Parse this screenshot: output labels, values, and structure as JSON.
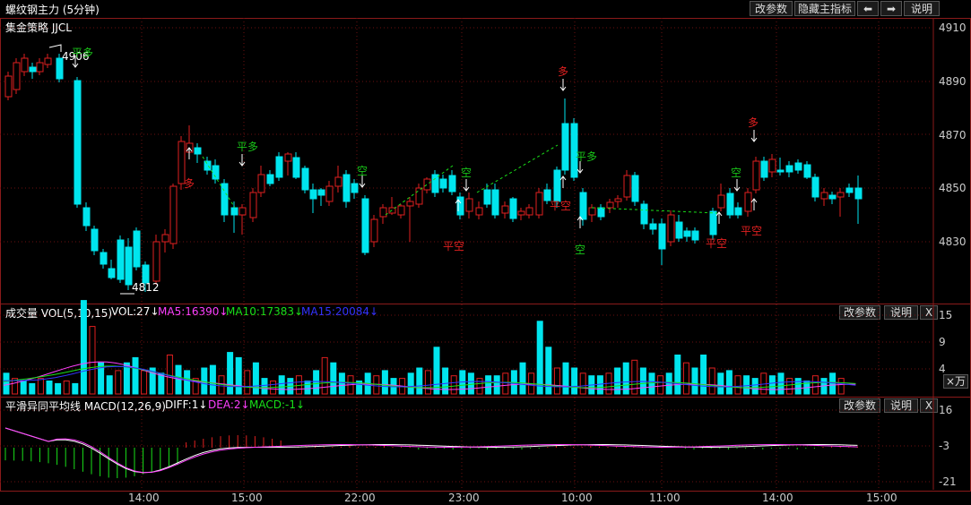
{
  "window": {
    "title": "螺纹钢主力 (5分钟)"
  },
  "toolbar": {
    "change_params": "改参数",
    "hide_main": "隐藏主指标",
    "prev": "⬅",
    "next": "➡",
    "help": "说明"
  },
  "strategy": {
    "name": "集金策略 JJCL"
  },
  "price_axis": {
    "ticks": [
      "4910",
      "4890",
      "4870",
      "4850",
      "4830"
    ]
  },
  "price_annotations": {
    "high": "4906",
    "low": "4812"
  },
  "signals": [
    {
      "text": "平多",
      "color": "#19c419"
    },
    {
      "text": "多",
      "color": "#e02020"
    },
    {
      "text": "平多",
      "color": "#19c419"
    },
    {
      "text": "空",
      "color": "#19c419"
    },
    {
      "text": "空",
      "color": "#19c419"
    },
    {
      "text": "平空",
      "color": "#e02020"
    },
    {
      "text": "多",
      "color": "#e02020"
    },
    {
      "text": "平多",
      "color": "#19c419"
    },
    {
      "text": "平空",
      "color": "#e02020"
    },
    {
      "text": "空",
      "color": "#19c419"
    },
    {
      "text": "空",
      "color": "#19c419"
    },
    {
      "text": "平空",
      "color": "#e02020"
    },
    {
      "text": "多",
      "color": "#e02020"
    },
    {
      "text": "平空",
      "color": "#e02020"
    }
  ],
  "volume": {
    "label": "成交量 VOL(5,10,15)",
    "vol": "VOL:27↓",
    "ma5": "MA5:16390↓",
    "ma10": "MA10:17383↓",
    "ma15": "MA15:20084↓",
    "change_params": "改参数",
    "help": "说明",
    "close": "X",
    "unit": "×万",
    "ticks": [
      "15",
      "9",
      "4"
    ]
  },
  "macd": {
    "label": "平滑异同平均线 MACD(12,26,9)",
    "diff": "DIFF:1↓",
    "dea": "DEA:2↓",
    "macd": "MACD:-1↓",
    "change_params": "改参数",
    "help": "说明",
    "close": "X",
    "ticks": [
      "16",
      "-3",
      "-21"
    ]
  },
  "time_axis": [
    "14:00",
    "15:00",
    "22:00",
    "23:00",
    "10:00",
    "11:00",
    "14:00",
    "15:00"
  ],
  "colors": {
    "up": "#e02020",
    "down": "#00e5ee",
    "ma5": "#ff40ff",
    "ma10": "#19e019",
    "ma15": "#3333ff",
    "grid": "#6b0f0f",
    "diff": "#ffffff",
    "dea": "#ff40ff"
  }
}
